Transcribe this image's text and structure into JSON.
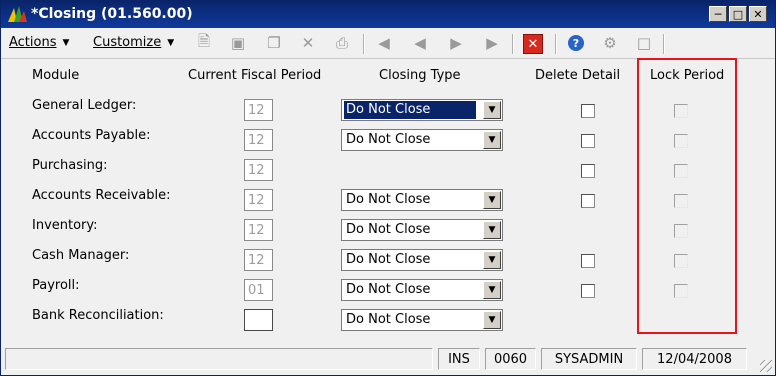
{
  "window": {
    "title": "*Closing (01.560.00)"
  },
  "toolbar": {
    "actions_label": "Actions",
    "customize_label": "Customize"
  },
  "headers": {
    "module": "Module",
    "fiscal_period": "Current Fiscal Period",
    "closing_type": "Closing Type",
    "delete_detail": "Delete Detail",
    "lock_period": "Lock Period"
  },
  "modules": [
    {
      "name": "General Ledger:",
      "period": "12",
      "closing_type": "Do Not Close",
      "has_combo": true,
      "selected": true,
      "has_delete": true
    },
    {
      "name": "Accounts Payable:",
      "period": "12",
      "closing_type": "Do Not Close",
      "has_combo": true,
      "selected": false,
      "has_delete": true
    },
    {
      "name": "Purchasing:",
      "period": "12",
      "closing_type": "",
      "has_combo": false,
      "selected": false,
      "has_delete": true
    },
    {
      "name": "Accounts Receivable:",
      "period": "12",
      "closing_type": "Do Not Close",
      "has_combo": true,
      "selected": false,
      "has_delete": true
    },
    {
      "name": "Inventory:",
      "period": "12",
      "closing_type": "Do Not Close",
      "has_combo": true,
      "selected": false,
      "has_delete": false
    },
    {
      "name": "Cash Manager:",
      "period": "12",
      "closing_type": "Do Not Close",
      "has_combo": true,
      "selected": false,
      "has_delete": true
    },
    {
      "name": "Payroll:",
      "period": "01",
      "closing_type": "Do Not Close",
      "has_combo": true,
      "selected": false,
      "has_delete": true
    },
    {
      "name": "Bank Reconciliation:",
      "period": "",
      "closing_type": "Do Not Close",
      "has_combo": true,
      "selected": false,
      "has_delete": false
    }
  ],
  "status": {
    "mode": "INS",
    "company": "0060",
    "user": "SYSADMIN",
    "date": "12/04/2008"
  },
  "colors": {
    "titlebar": "#0a246a",
    "highlight": "#e8141c",
    "selection": "#0a246a"
  }
}
